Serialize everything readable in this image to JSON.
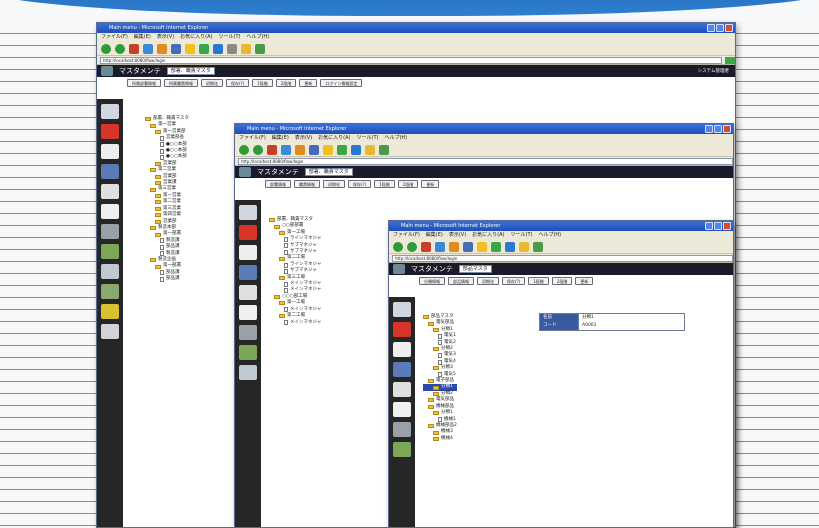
{
  "window_title": "Main menu - Microsoft Internet Explorer",
  "menu": [
    "ファイル(F)",
    "編集(E)",
    "表示(V)",
    "お気に入り(A)",
    "ツール(T)",
    "ヘルプ(H)"
  ],
  "address": "http://localhost:8080/flow/login",
  "app_title": "マスタメンテ",
  "win1": {
    "select": "部署、職責マスタ",
    "tabs": [
      "所属部署情報",
      "所属職責情報",
      "初期化",
      "保存(?)",
      "1段階",
      "2段階",
      "更新",
      "ログイン情報設定"
    ],
    "header_right": "システム管理者",
    "tree": [
      "部署、職責マスタ",
      "第一営業",
      "第一営業部",
      "営業部長",
      "●○○本部",
      "●○○本部",
      "●○○本部",
      "営業部",
      "第二営業",
      "営業部",
      "営業課",
      "第三営業",
      "第一営業",
      "第二営業",
      "第三営業",
      "第四営業",
      "営業部",
      "製造本部",
      "第一部署",
      "製造課",
      "部品課",
      "製造課",
      "製造企画",
      "第一部署",
      "部品課",
      "部品課"
    ]
  },
  "win2": {
    "select": "部署、職責マスタ",
    "tabs": [
      "部署情報",
      "職責情報",
      "初期化",
      "保存(?)",
      "1段階",
      "2段階",
      "更新"
    ],
    "tree": [
      "部署、職責マスタ",
      "○○部部署",
      "第一工場",
      "ラインマネジャ",
      "サブマネジャ",
      "サブマネジャ",
      "第二工場",
      "ラインマネジャ",
      "サブマネジャ",
      "第三工場",
      "メインマネジャ",
      "メインマネジャ",
      "○○○部工場",
      "第一工場",
      "メインマネジャ",
      "第二工場",
      "メインマネジャ"
    ]
  },
  "win3": {
    "select": "部品マスタ",
    "tabs": [
      "分類情報",
      "部品情報",
      "初期化",
      "保存(?)",
      "1段階",
      "2段階",
      "更新"
    ],
    "tree": [
      "部品マスタ",
      "電気部品",
      "分類1",
      "電気1",
      "電気2",
      "分類2",
      "電気3",
      "電気4",
      "分類3",
      "電気5",
      "電子部品",
      "分類1",
      "分類2",
      "電気部品",
      "機械部品",
      "分類1",
      "機械1",
      "機械部品2",
      "機械3",
      "機械4"
    ],
    "fields": [
      {
        "label": "名前",
        "value": "分類1"
      },
      {
        "label": "コード",
        "value": "A0001"
      }
    ]
  },
  "colors": {
    "banner": "#2f7fd0",
    "app_header": "#1a1a2a",
    "sidebar": "#262626",
    "title_bar": "#1e4fb8"
  }
}
